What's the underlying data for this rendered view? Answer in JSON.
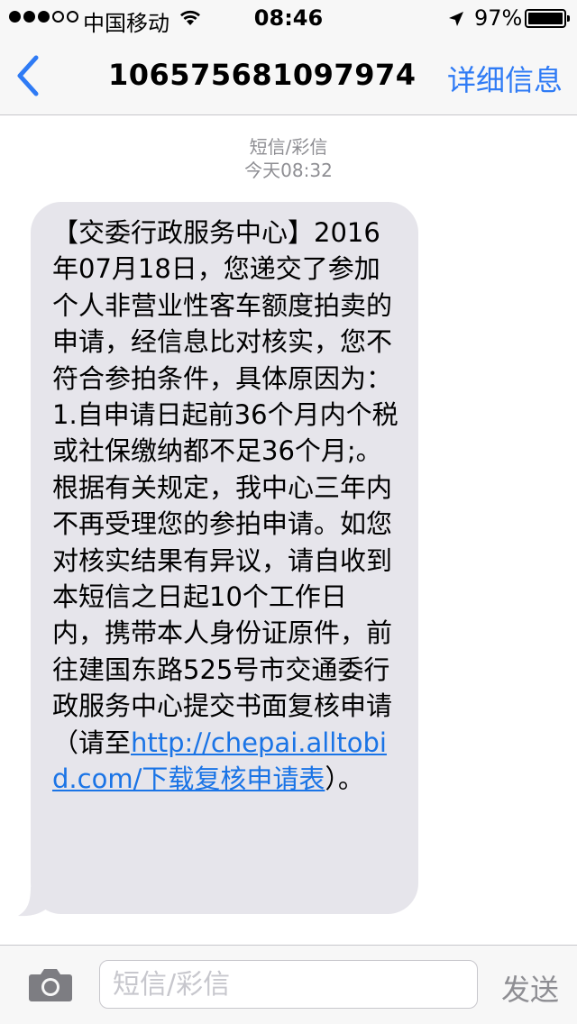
{
  "status_bar": {
    "carrier": "中国移动",
    "time": "08:46",
    "battery": "97%",
    "battery_level": 0.97,
    "signal_filled": 3,
    "signal_total": 5
  },
  "nav": {
    "back_icon": "chevron-left-icon",
    "title": "10657568109797​4...",
    "details_label": "详细信息"
  },
  "thread": {
    "type_label": "短信/彩信",
    "timestamp": "今天08:32",
    "message": {
      "text_before_link": "【交委行政服务中心】2016年07月18日，您递交了参加个人非营业性客车额度拍卖的申请，经信息比对核实，您不符合参拍条件，具体原因为：1.自申请日起前36个月内个税或社保缴纳都不足36个月;。根据有关规定，我中心三年内不再受理您的参拍申请。如您对核实结果有异议，请自收到本短信之日起10个工作日内，携带本人身份证原件，前往建国东路525号市交通委行政服务中心提交书面复核申请（请至",
      "link_text": "http://chepai.alltobid.com/下载复核申请表",
      "text_after_link": "）。"
    }
  },
  "input": {
    "camera_icon": "camera-icon",
    "placeholder": "短信/彩信",
    "send_label": "发送"
  },
  "colors": {
    "accent": "#2f7bf5",
    "bubble": "#e6e5eb",
    "bar": "#f7f7f7",
    "link": "#1a74e6"
  }
}
